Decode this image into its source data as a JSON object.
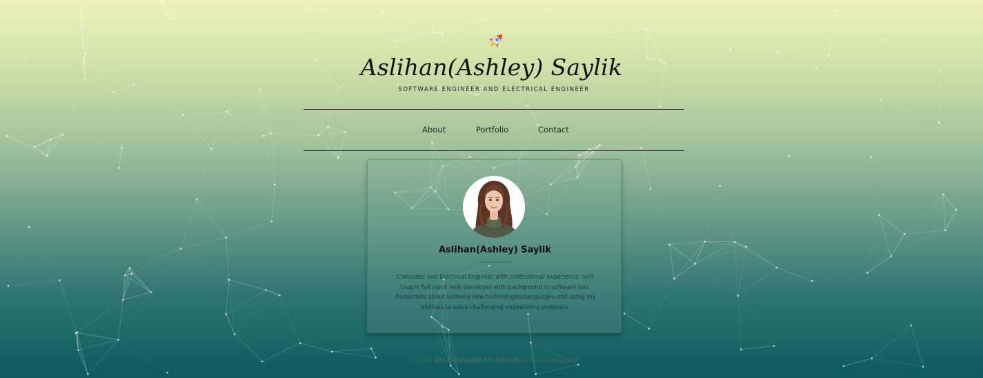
{
  "header": {
    "rocket_icon": "rocket-icon",
    "title": "Aslihan(Ashley) Saylik",
    "subtitle": "SOFTWARE ENGINEER AND ELECTRICAL ENGINEER"
  },
  "nav": {
    "items": [
      {
        "label": "About"
      },
      {
        "label": "Portfolio"
      },
      {
        "label": "Contact"
      }
    ]
  },
  "profile_card": {
    "name": "Aslihan(Ashley) Saylik",
    "bio": "Computer and Electrical Engineer with professional experience. Self-taught full stack web developer with background in software test. Passionate about learning new technologies/languages and using my abilities to solve challenging engineering problems."
  },
  "footer": {
    "prefix": "© 2019",
    "brand": "ASLIHAN(ASHLEY) SAYLIK",
    "suffix": "All Rights Reserved"
  },
  "colors": {
    "gradient_top": "#eef2bb",
    "gradient_bottom": "#0c5a5e",
    "text_dark": "#111111"
  }
}
